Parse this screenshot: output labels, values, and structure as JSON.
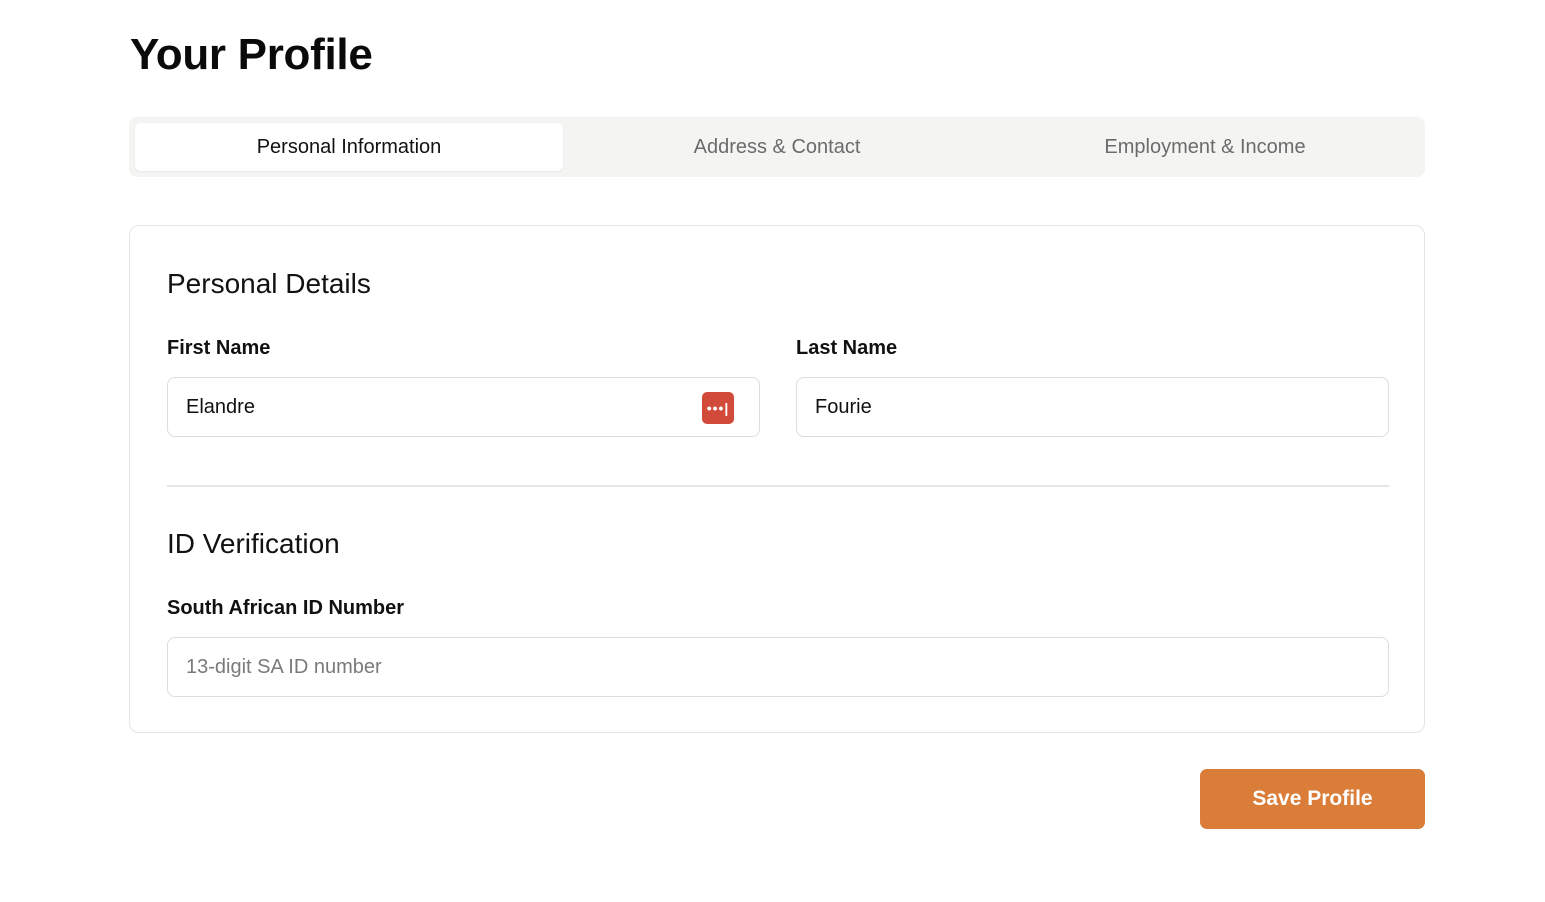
{
  "page": {
    "title": "Your Profile"
  },
  "tabs": [
    {
      "label": "Personal Information",
      "active": true
    },
    {
      "label": "Address & Contact",
      "active": false
    },
    {
      "label": "Employment & Income",
      "active": false
    }
  ],
  "personal_details": {
    "title": "Personal Details",
    "first_name": {
      "label": "First Name",
      "value": "Elandre",
      "icon": "password-manager-icon",
      "icon_glyph": "•••|"
    },
    "last_name": {
      "label": "Last Name",
      "value": "Fourie"
    }
  },
  "id_verification": {
    "title": "ID Verification",
    "id_number": {
      "label": "South African ID Number",
      "value": "",
      "placeholder": "13-digit SA ID number"
    }
  },
  "actions": {
    "save_label": "Save Profile"
  },
  "colors": {
    "accent": "#d97d38",
    "password_manager": "#d24a3a",
    "tab_bar": "#f4f4f2"
  }
}
